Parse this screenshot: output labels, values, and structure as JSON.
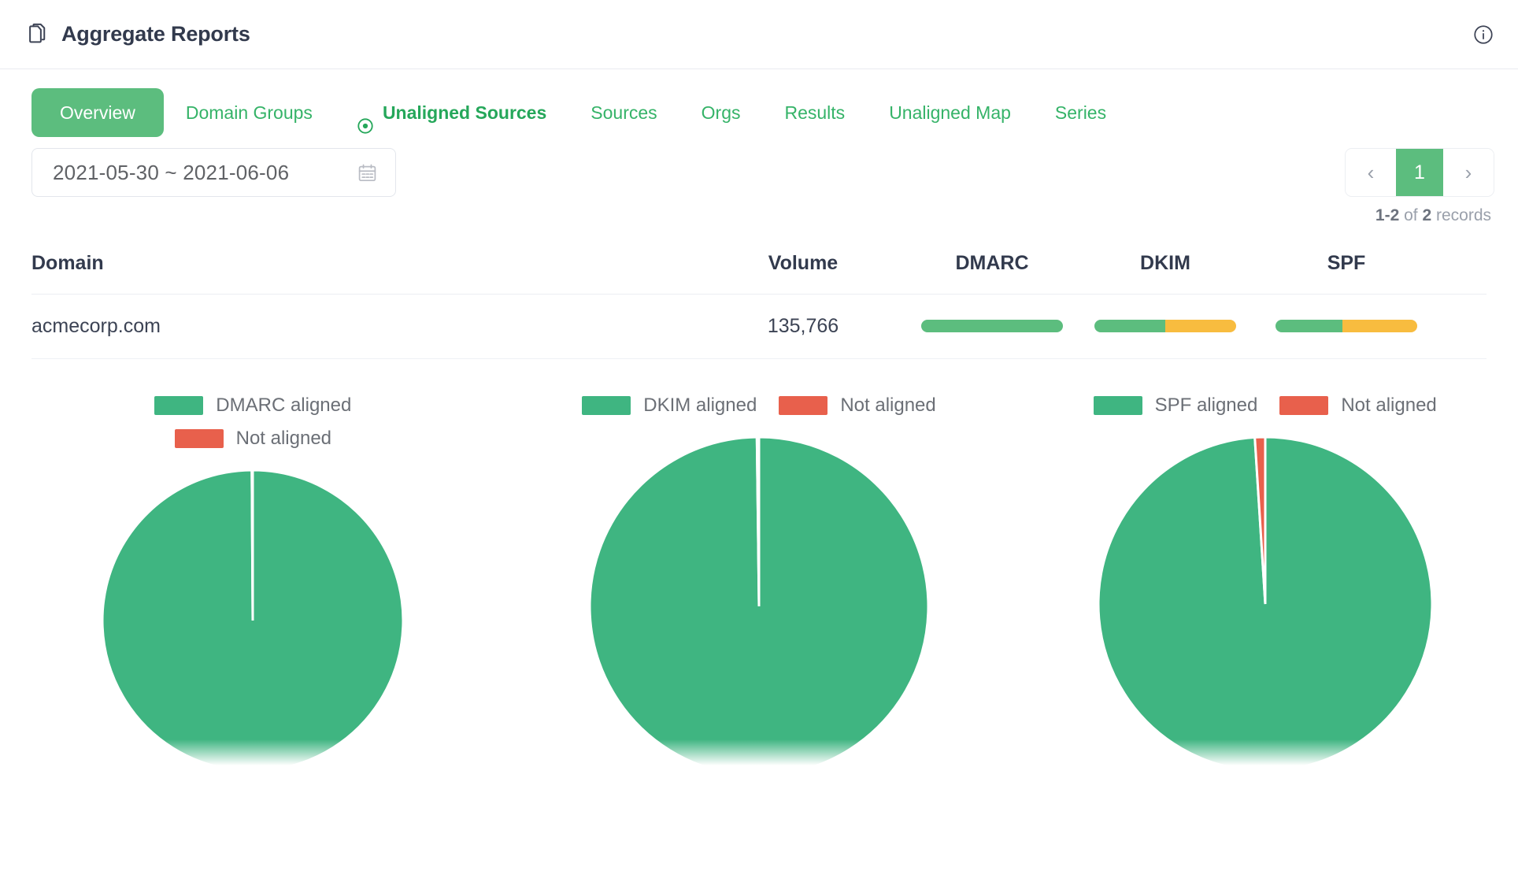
{
  "header": {
    "title": "Aggregate Reports",
    "doc_icon": "documents-icon",
    "info_icon": "info-circle-icon"
  },
  "tabs": [
    {
      "label": "Overview",
      "state": "active"
    },
    {
      "label": "Domain Groups",
      "state": "normal"
    },
    {
      "label": "Unaligned Sources",
      "state": "current",
      "icon": "target-dot-icon"
    },
    {
      "label": "Sources",
      "state": "normal"
    },
    {
      "label": "Orgs",
      "state": "normal"
    },
    {
      "label": "Results",
      "state": "normal"
    },
    {
      "label": "Unaligned Map",
      "state": "normal"
    },
    {
      "label": "Series",
      "state": "normal"
    }
  ],
  "controls": {
    "date_range": "2021-05-30 ~ 2021-06-06",
    "calendar_icon": "calendar-icon",
    "pager": {
      "prev": "‹",
      "next": "›",
      "current_page": "1",
      "records_prefix": "1-2",
      "records_middle": " of ",
      "records_count": "2",
      "records_suffix": " records"
    }
  },
  "table": {
    "columns": [
      "Domain",
      "Volume",
      "DMARC",
      "DKIM",
      "SPF"
    ],
    "rows": [
      {
        "domain": "acmecorp.com",
        "volume": "135,766",
        "dmarc_pct": 100,
        "dkim_pct": 50,
        "spf_pct": 47
      }
    ]
  },
  "colors": {
    "green": "#5cbd7e",
    "pie_green": "#3fb581",
    "amber": "#f8bc3f",
    "red": "#e8604c",
    "tab_green": "#35b368",
    "title": "#323a4d"
  },
  "chart_data": [
    {
      "type": "pie",
      "title": "DMARC alignment",
      "legend_position": "top",
      "labels": [
        "DMARC aligned",
        "Not aligned"
      ],
      "values": [
        99.9,
        0.1
      ],
      "colors": [
        "#3fb581",
        "#e8604c"
      ]
    },
    {
      "type": "pie",
      "title": "DKIM alignment",
      "legend_position": "top",
      "labels": [
        "DKIM aligned",
        "Not aligned"
      ],
      "values": [
        99.8,
        0.2
      ],
      "colors": [
        "#3fb581",
        "#e8604c"
      ]
    },
    {
      "type": "pie",
      "title": "SPF alignment",
      "legend_position": "top",
      "labels": [
        "SPF aligned",
        "Not aligned"
      ],
      "values": [
        99.0,
        1.0
      ],
      "colors": [
        "#3fb581",
        "#e8604c"
      ]
    }
  ]
}
